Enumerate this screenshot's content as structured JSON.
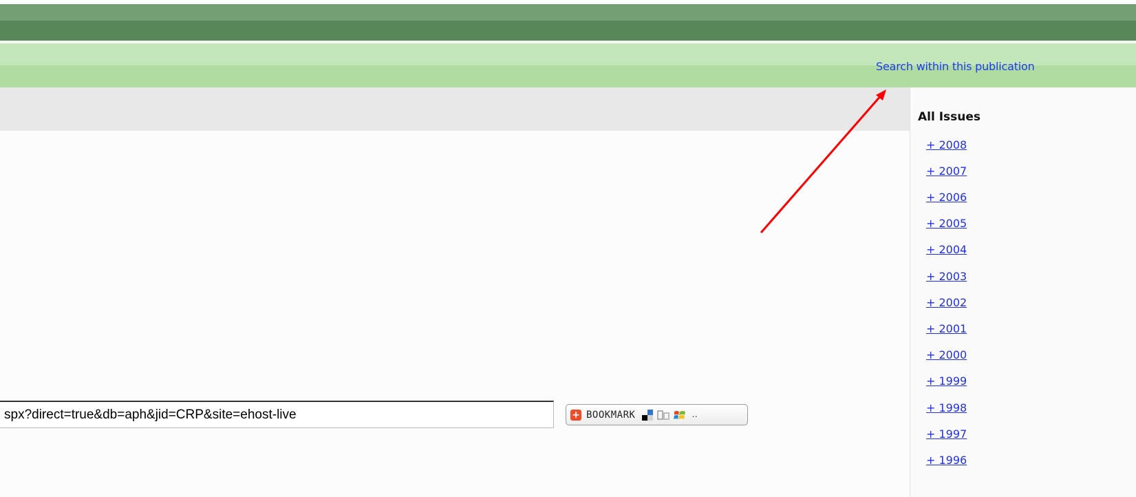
{
  "header": {
    "search_link": "Search within this publication"
  },
  "sidebar": {
    "title": "All Issues",
    "years": [
      "+ 2008",
      "+ 2007",
      "+ 2006",
      "+ 2005",
      "+ 2004",
      "+ 2003",
      "+ 2002",
      "+ 2001",
      "+ 2000",
      "+ 1999",
      "+ 1998",
      "+ 1997",
      "+ 1996"
    ]
  },
  "permalink": {
    "value": "spx?direct=true&db=aph&jid=CRP&site=ehost-live"
  },
  "bookmark": {
    "plus": "+",
    "label": "BOOKMARK",
    "ellipsis": "..",
    "icons": [
      "delicious-icon",
      "digg-icon",
      "windows-live-icon"
    ]
  },
  "colors": {
    "header_dark": "#58885a",
    "header_light": "#b0dca2",
    "link": "#1f2ff0",
    "arrow": "#ff0000"
  }
}
